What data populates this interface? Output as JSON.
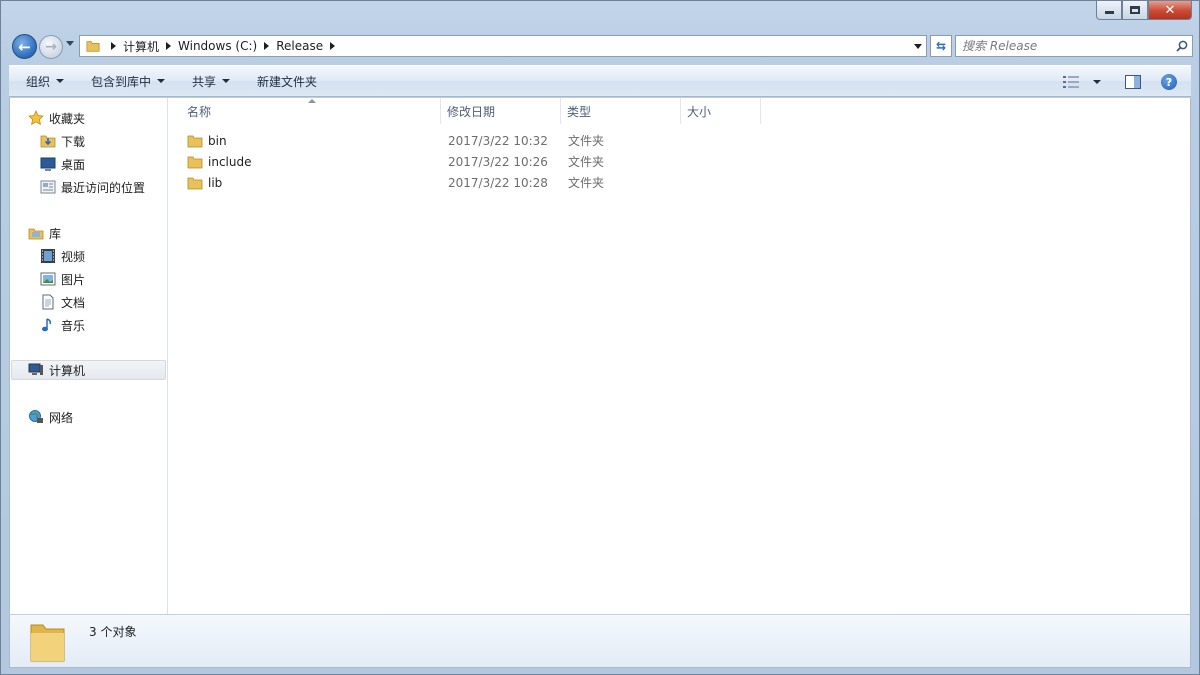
{
  "window": {
    "caption": {
      "minimize": "minimize",
      "maximize": "maximize",
      "close": "close"
    }
  },
  "navigation": {
    "breadcrumbs": [
      "计算机",
      "Windows (C:)",
      "Release"
    ],
    "search_placeholder": "搜索 Release"
  },
  "toolbar": {
    "organize": "组织",
    "include_in_library": "包含到库中",
    "share": "共享",
    "new_folder": "新建文件夹"
  },
  "sidebar": {
    "favorites": {
      "label": "收藏夹",
      "items": [
        "下载",
        "桌面",
        "最近访问的位置"
      ]
    },
    "libraries": {
      "label": "库",
      "items": [
        "视频",
        "图片",
        "文档",
        "音乐"
      ]
    },
    "computer": "计算机",
    "network": "网络"
  },
  "file_list": {
    "columns": [
      "名称",
      "修改日期",
      "类型",
      "大小"
    ],
    "rows": [
      {
        "name": "bin",
        "date": "2017/3/22 10:32",
        "type": "文件夹"
      },
      {
        "name": "include",
        "date": "2017/3/22 10:26",
        "type": "文件夹"
      },
      {
        "name": "lib",
        "date": "2017/3/22 10:28",
        "type": "文件夹"
      }
    ]
  },
  "details": {
    "count": "3 个对象"
  },
  "colors": {
    "folder": "#e8c15a",
    "accent": "#2c6ab8",
    "close": "#c94a34"
  }
}
